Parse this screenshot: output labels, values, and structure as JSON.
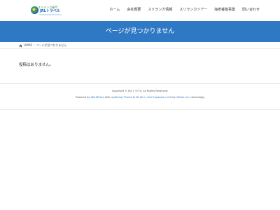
{
  "header": {
    "logo": {
      "line1": "スリランカ専門",
      "line2": "JRLトラベル"
    },
    "nav": [
      "ホーム",
      "会社概要",
      "スリランカ情報",
      "スリランカツアー",
      "海老養殖事業",
      "問い合わせ"
    ]
  },
  "hero": {
    "title": "ページが見つかりません"
  },
  "breadcrumb": {
    "home_label": "HOME",
    "separator": "/",
    "current": "ページが見つかりません"
  },
  "content": {
    "message": "投稿はありません。"
  },
  "footer": {
    "copyright": "Copyright © JRLトラベル All Rights Reserved.",
    "powered_prefix": "Powered by",
    "wordpress": "WordPress",
    "with": "with",
    "theme": "Lightning Theme",
    "amp": "&",
    "plugin": "VK All in One Expansion Unit",
    "by": "by",
    "company": "Vektor,Inc.",
    "technology": "technology"
  },
  "colors": {
    "accent": "#2e78c4",
    "hero_text": "#ffffff"
  }
}
